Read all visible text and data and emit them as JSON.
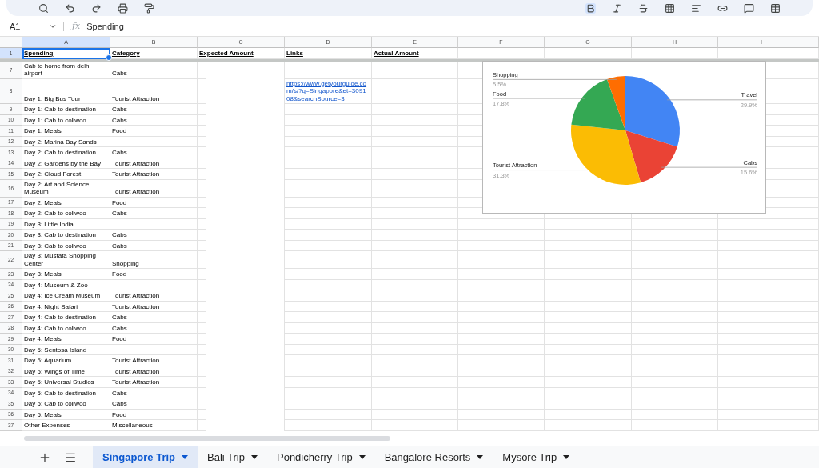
{
  "formula_bar": {
    "cell_ref": "A1",
    "function_label": "ƒx",
    "formula": "Spending"
  },
  "columns": [
    {
      "label": "A",
      "selected": true
    },
    {
      "label": "B",
      "selected": false
    },
    {
      "label": "C",
      "selected": false
    },
    {
      "label": "D",
      "selected": false
    },
    {
      "label": "E",
      "selected": false
    },
    {
      "label": "F",
      "selected": false
    },
    {
      "label": "G",
      "selected": false
    },
    {
      "label": "H",
      "selected": false
    },
    {
      "label": "I",
      "selected": false
    }
  ],
  "header_row": {
    "number": "1",
    "selected": true,
    "cells": [
      "Spending",
      "Category",
      "Expected Amount",
      "Links",
      "Actual Amount"
    ]
  },
  "rows": [
    {
      "number": "7",
      "spending": "Cab to home from delhi airport",
      "category": "Cabs"
    },
    {
      "number": "8",
      "spending": "Day 1: Big Bus Tour",
      "category": "Tourist Attraction",
      "link": "https://www.getyourguide.com/s/?q=Singapore&et=309108&searchSource=3"
    },
    {
      "number": "9",
      "spending": "Day 1: Cab to destination",
      "category": "Cabs"
    },
    {
      "number": "10",
      "spending": "Day 1: Cab to coliwoo",
      "category": "Cabs"
    },
    {
      "number": "11",
      "spending": "Day 1: Meals",
      "category": "Food"
    },
    {
      "number": "12",
      "spending": "Day 2: Marina Bay Sands"
    },
    {
      "number": "13",
      "spending": "Day 2: Cab to destination",
      "category": "Cabs"
    },
    {
      "number": "14",
      "spending": "Day 2: Gardens by the Bay",
      "category": "Tourist Attraction"
    },
    {
      "number": "15",
      "spending": "Day 2: Cloud Forest",
      "category": "Tourist Attraction"
    },
    {
      "number": "16",
      "spending": "Day 2: Art and Science Museum",
      "category": "Tourist Attraction"
    },
    {
      "number": "17",
      "spending": "Day 2: Meals",
      "category": "Food"
    },
    {
      "number": "18",
      "spending": "Day 2: Cab to coliwoo",
      "category": "Cabs"
    },
    {
      "number": "19",
      "spending": "Day 3: Little India"
    },
    {
      "number": "20",
      "spending": "Day 3: Cab to destination",
      "category": "Cabs"
    },
    {
      "number": "21",
      "spending": "Day 3: Cab to coliwoo",
      "category": "Cabs"
    },
    {
      "number": "22",
      "spending": "Day 3: Mustafa Shopping Center",
      "category": "Shopping"
    },
    {
      "number": "23",
      "spending": "Day 3: Meals",
      "category": "Food"
    },
    {
      "number": "24",
      "spending": "Day 4: Museum & Zoo"
    },
    {
      "number": "25",
      "spending": "Day 4: Ice Cream Museum",
      "category": "Tourist Attraction"
    },
    {
      "number": "26",
      "spending": "Day 4: Night Safari",
      "category": "Tourist Attraction"
    },
    {
      "number": "27",
      "spending": "Day 4: Cab to destination",
      "category": "Cabs"
    },
    {
      "number": "28",
      "spending": "Day 4: Cab to coliwoo",
      "category": "Cabs"
    },
    {
      "number": "29",
      "spending": "Day 4: Meals",
      "category": "Food"
    },
    {
      "number": "30",
      "spending": "Day 5: Sentosa Island"
    },
    {
      "number": "31",
      "spending": "Day 5: Aquarium",
      "category": "Tourist Attraction"
    },
    {
      "number": "32",
      "spending": "Day 5: Wings of Time",
      "category": "Tourist Attraction"
    },
    {
      "number": "33",
      "spending": "Day 5: Universal Studios",
      "category": "Tourist Attraction"
    },
    {
      "number": "34",
      "spending": "Day 5: Cab to destination",
      "category": "Cabs"
    },
    {
      "number": "35",
      "spending": "Day 5: Cab to coliwoo",
      "category": "Cabs"
    },
    {
      "number": "36",
      "spending": "Day 5: Meals",
      "category": "Food"
    },
    {
      "number": "37",
      "spending": "Other Expenses",
      "category": "Miscellaneous"
    }
  ],
  "chart": {
    "chart_data": {
      "type": "pie",
      "categories": [
        "Travel",
        "Cabs",
        "Tourist Attraction",
        "Food",
        "Shopping"
      ],
      "series": [
        {
          "values": [
            29.9,
            15.6,
            31.3,
            17.8,
            5.5
          ]
        }
      ],
      "colors": [
        "#4285f4",
        "#ea4335",
        "#fbbc04",
        "#34a853",
        "#ff6d01"
      ],
      "value_labels": [
        "29.9%",
        "15.6%",
        "31.3%",
        "17.8%",
        "5.5%"
      ]
    }
  },
  "sheet_tabs": [
    {
      "label": "Singapore Trip",
      "selected": true
    },
    {
      "label": "Bali Trip",
      "selected": false
    },
    {
      "label": "Pondicherry Trip",
      "selected": false
    },
    {
      "label": "Bangalore Resorts",
      "selected": false
    },
    {
      "label": "Mysore Trip",
      "selected": false
    }
  ]
}
